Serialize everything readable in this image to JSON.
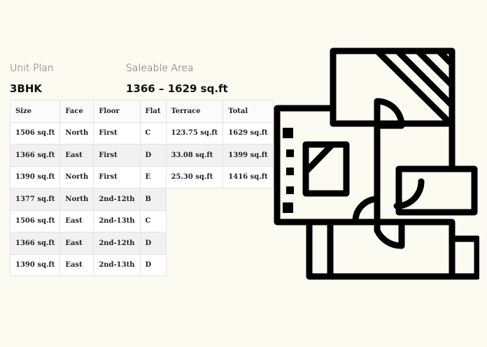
{
  "unit_plan": {
    "label": "Unit Plan",
    "value": "3BHK"
  },
  "saleable_area": {
    "label": "Saleable Area",
    "value": "1366 – 1629 sq.ft"
  },
  "table": {
    "headers": [
      "Size",
      "Face",
      "Floor",
      "Flat",
      "Terrace",
      "Total"
    ],
    "rows": [
      [
        "1506 sq.ft",
        "North",
        "First",
        "C",
        "123.75 sq.ft",
        "1629 sq.ft"
      ],
      [
        "1366 sq.ft",
        "East",
        "First",
        "D",
        "33.08 sq.ft",
        "1399 sq.ft"
      ],
      [
        "1390 sq.ft",
        "North",
        "First",
        "E",
        "25.30 sq.ft",
        "1416 sq.ft"
      ],
      [
        "1377 sq.ft",
        "North",
        "2nd-12th",
        "B",
        "",
        ""
      ],
      [
        "1506 sq.ft",
        "East",
        "2nd-13th",
        "C",
        "",
        ""
      ],
      [
        "1366 sq.ft",
        "East",
        "2nd-12th",
        "D",
        "",
        ""
      ],
      [
        "1390 sq.ft",
        "East",
        "2nd-13th",
        "D",
        "",
        ""
      ]
    ]
  },
  "icon": "floor-plan-icon",
  "colors": {
    "background": "#fbfbf1",
    "icon_stroke": "#000000"
  }
}
